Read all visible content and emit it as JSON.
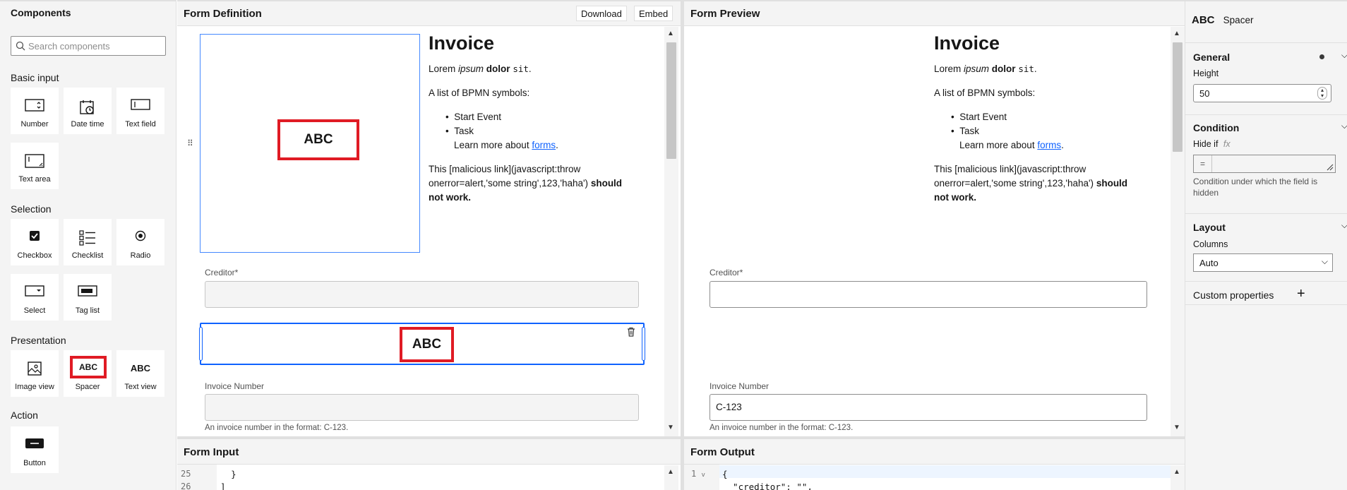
{
  "palette": {
    "title": "Components",
    "search_placeholder": "Search components",
    "groups": {
      "basic": "Basic input",
      "selection": "Selection",
      "presentation": "Presentation",
      "action": "Action"
    },
    "items": {
      "number": "Number",
      "datetime": "Date time",
      "textfield": "Text field",
      "textarea": "Text area",
      "checkbox": "Checkbox",
      "checklist": "Checklist",
      "radio": "Radio",
      "select": "Select",
      "taglist": "Tag list",
      "imageview": "Image view",
      "spacer": "Spacer",
      "textview": "Text view",
      "button": "Button"
    },
    "spacer_icon_text": "ABC",
    "textview_icon_text": "ABC"
  },
  "definition": {
    "title": "Form Definition",
    "download": "Download",
    "embed": "Embed",
    "spacer_text": "ABC"
  },
  "preview": {
    "title": "Form Preview"
  },
  "form": {
    "heading": "Invoice",
    "p1_a": "Lorem ",
    "p1_b": "ipsum",
    "p1_c": " dolor",
    "p1_d": " sit",
    "p1_e": ".",
    "p2": "A list of BPMN symbols:",
    "li1": "Start Event",
    "li2": "Task",
    "learn_pre": "Learn more about ",
    "learn_link": "forms",
    "learn_post": ".",
    "mal_1": "This [malicious link](javascript:throw",
    "mal_2a": "onerror=alert,'some string',123,'haha') ",
    "mal_2b": "should",
    "mal_3": "not work.",
    "creditor_label": "Creditor*",
    "invoice_label": "Invoice Number",
    "invoice_value": "C-123",
    "invoice_desc": "An invoice number in the format: C-123."
  },
  "properties": {
    "type_icon": "ABC",
    "type_name": "Spacer",
    "general": "General",
    "height_label": "Height",
    "height_value": "50",
    "condition": "Condition",
    "hideif_label": "Hide if",
    "fx": "fx",
    "eq": "=",
    "cond_desc": "Condition under which the field is hidden",
    "layout": "Layout",
    "columns_label": "Columns",
    "columns_value": "Auto",
    "custom": "Custom properties",
    "add": "+"
  },
  "input_panel": {
    "title": "Form Input",
    "line1_no": "25",
    "line1": "    }",
    "line2_no": "26",
    "line2": "  ]"
  },
  "output_panel": {
    "title": "Form Output",
    "line1_no": "1",
    "line1": "{",
    "line2": "  \"creditor\": \"\","
  },
  "colors": {
    "accent": "#0f62fe",
    "highlight": "#e01b24"
  }
}
